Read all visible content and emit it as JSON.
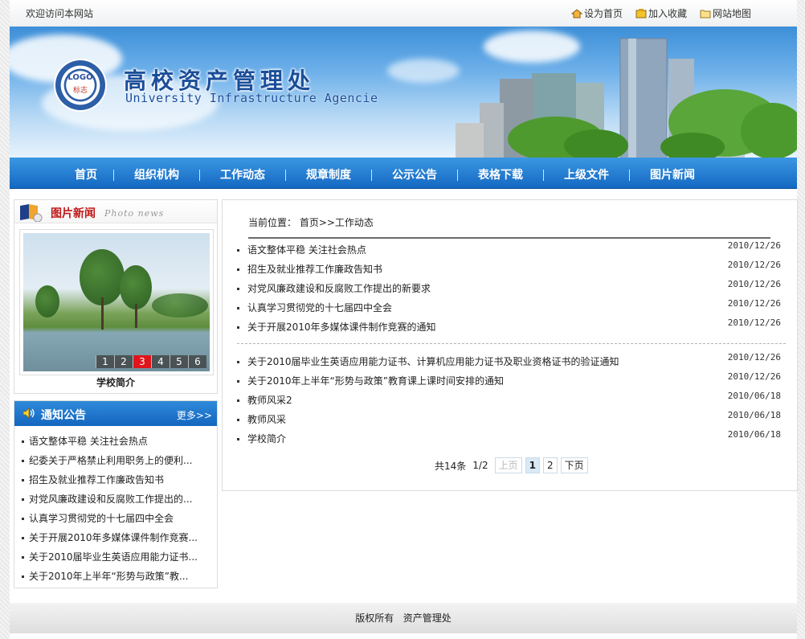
{
  "topbar": {
    "welcome": "欢迎访问本网站",
    "links": [
      "设为首页",
      "加入收藏",
      "网站地图"
    ]
  },
  "banner": {
    "title_cn": "高校资产管理处",
    "title_en": "University Infrastructure Agencie",
    "logo_text": "LOGO",
    "logo_sub": "标志"
  },
  "nav": [
    "首页",
    "组织机构",
    "工作动态",
    "规章制度",
    "公示公告",
    "表格下载",
    "上级文件",
    "图片新闻"
  ],
  "photo_news": {
    "title": "图片新闻",
    "title_en": "Photo news",
    "thumbs": [
      "1",
      "2",
      "3",
      "4",
      "5",
      "6"
    ],
    "active": "3",
    "caption": "学校简介"
  },
  "notice": {
    "title": "通知公告",
    "more": "更多>>",
    "items": [
      "语文整体平稳 关注社会热点",
      "纪委关于严格禁止利用职务上的便利...",
      "招生及就业推荐工作廉政告知书",
      "对党风廉政建设和反腐败工作提出的...",
      "认真学习贯彻党的十七届四中全会",
      "关于开展2010年多媒体课件制作竞赛...",
      "关于2010届毕业生英语应用能力证书...",
      "关于2010年上半年“形势与政策”教..."
    ]
  },
  "main": {
    "breadcrumb": "当前位置：  首页>>工作动态",
    "group1": [
      {
        "title": "语文整体平稳 关注社会热点",
        "date": "2010/12/26"
      },
      {
        "title": "招生及就业推荐工作廉政告知书",
        "date": "2010/12/26"
      },
      {
        "title": "对党风廉政建设和反腐败工作提出的新要求",
        "date": "2010/12/26"
      },
      {
        "title": "认真学习贯彻党的十七届四中全会",
        "date": "2010/12/26"
      },
      {
        "title": "关于开展2010年多媒体课件制作竞赛的通知",
        "date": "2010/12/26"
      }
    ],
    "group2": [
      {
        "title": "关于2010届毕业生英语应用能力证书、计算机应用能力证书及职业资格证书的验证通知",
        "date": "2010/12/26"
      },
      {
        "title": "关于2010年上半年“形势与政策”教育课上课时间安排的通知",
        "date": "2010/12/26"
      },
      {
        "title": "教师风采2",
        "date": "2010/06/18"
      },
      {
        "title": "教师风采",
        "date": "2010/06/18"
      },
      {
        "title": "学校简介",
        "date": "2010/06/18"
      }
    ],
    "pager": {
      "total": "共14条",
      "page_info": "1/2",
      "prev": "上页",
      "pages": [
        "1",
        "2"
      ],
      "next": "下页"
    }
  },
  "footer": "版权所有   资产管理处"
}
